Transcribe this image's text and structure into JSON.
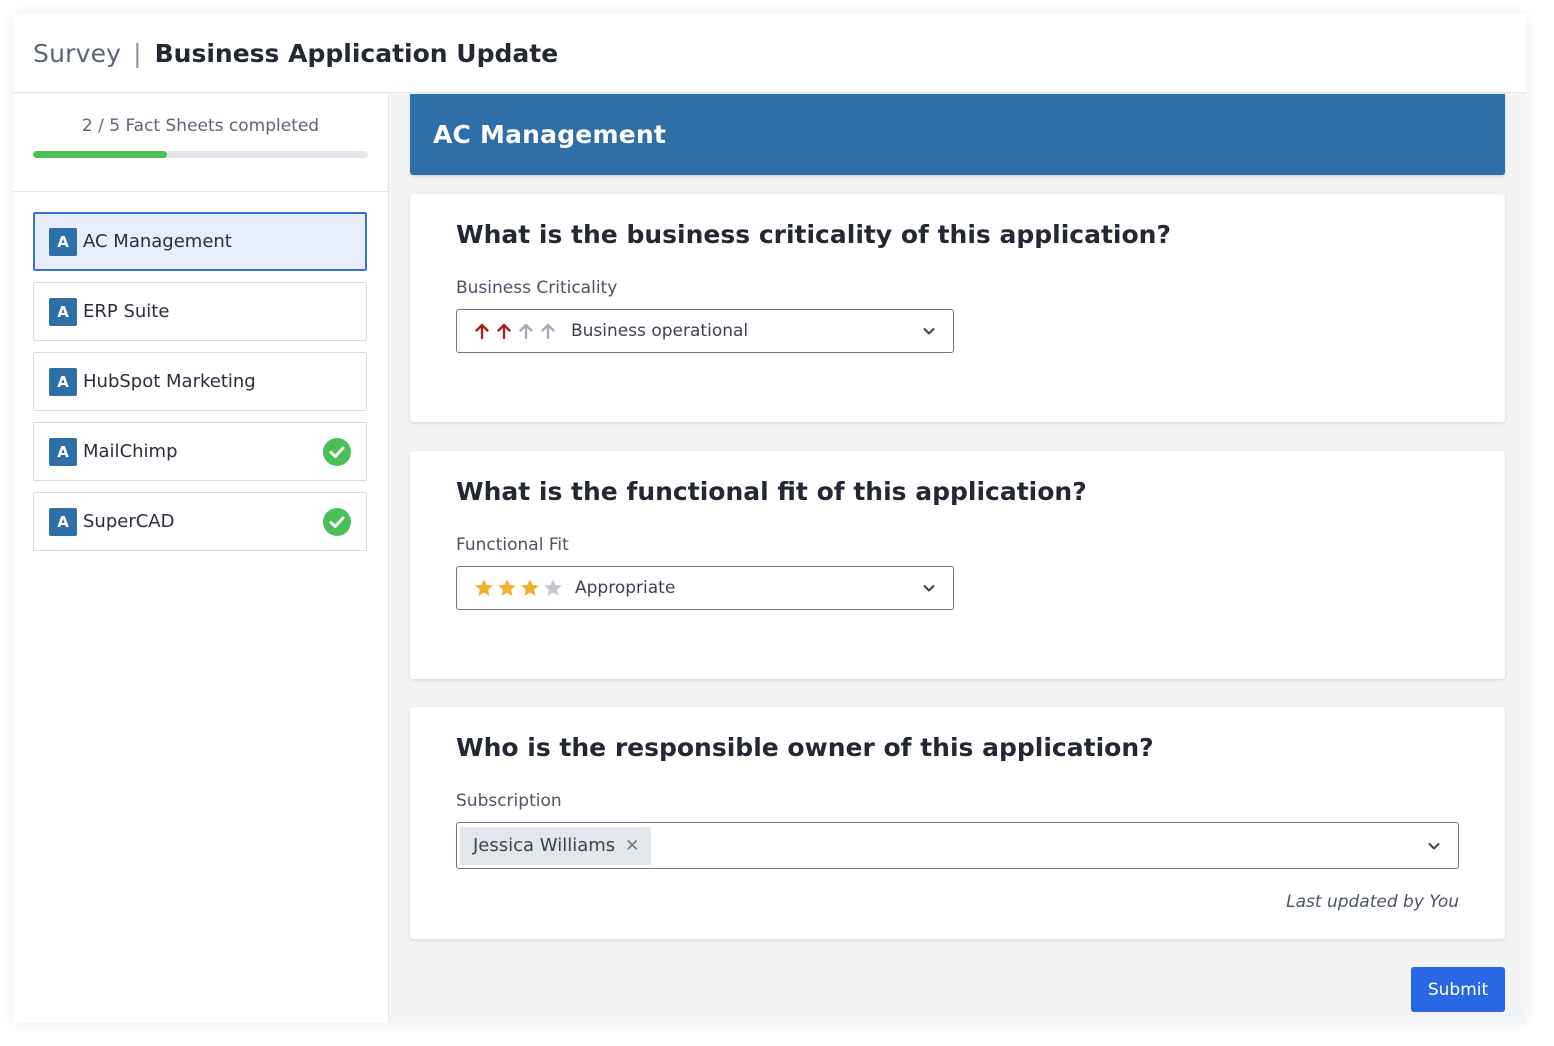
{
  "header": {
    "section": "Survey",
    "separator": "|",
    "title": "Business Application Update"
  },
  "sidebar": {
    "progress": {
      "text": "2 / 5 Fact Sheets completed",
      "completed": 2,
      "total": 5,
      "fill_color": "#4cbe56"
    },
    "items": [
      {
        "badge": "A",
        "label": "AC Management",
        "active": true,
        "completed": false
      },
      {
        "badge": "A",
        "label": "ERP Suite",
        "active": false,
        "completed": false
      },
      {
        "badge": "A",
        "label": "HubSpot Marketing",
        "active": false,
        "completed": false
      },
      {
        "badge": "A",
        "label": "MailChimp",
        "active": false,
        "completed": true
      },
      {
        "badge": "A",
        "label": "SuperCAD",
        "active": false,
        "completed": true
      }
    ]
  },
  "main": {
    "fact_sheet_title": "AC Management",
    "questions": [
      {
        "title": "What is the business criticality of this application?",
        "field_label": "Business Criticality",
        "value": "Business operational",
        "rating": {
          "level": 2,
          "max": 4,
          "icon": "arrow-up-icon",
          "active_color": "#a3241f",
          "inactive_color": "#a6adb8"
        }
      },
      {
        "title": "What is the functional fit of this application?",
        "field_label": "Functional Fit",
        "value": "Appropriate",
        "rating": {
          "level": 3,
          "max": 4,
          "icon": "star-icon",
          "active_color": "#f0b22a",
          "inactive_color": "#c4c9d1"
        }
      },
      {
        "title": "Who is the responsible owner of this application?",
        "field_label": "Subscription",
        "tags": [
          "Jessica Williams"
        ],
        "remove_glyph": "✕",
        "updated": "Last updated by You"
      }
    ],
    "submit_label": "Submit"
  },
  "colors": {
    "accent": "#2f6fa7",
    "primary_button": "#2a67e4",
    "active_item_bg": "#e7edfa",
    "active_item_border": "#3a6fd8",
    "check_green": "#4cbe56"
  }
}
